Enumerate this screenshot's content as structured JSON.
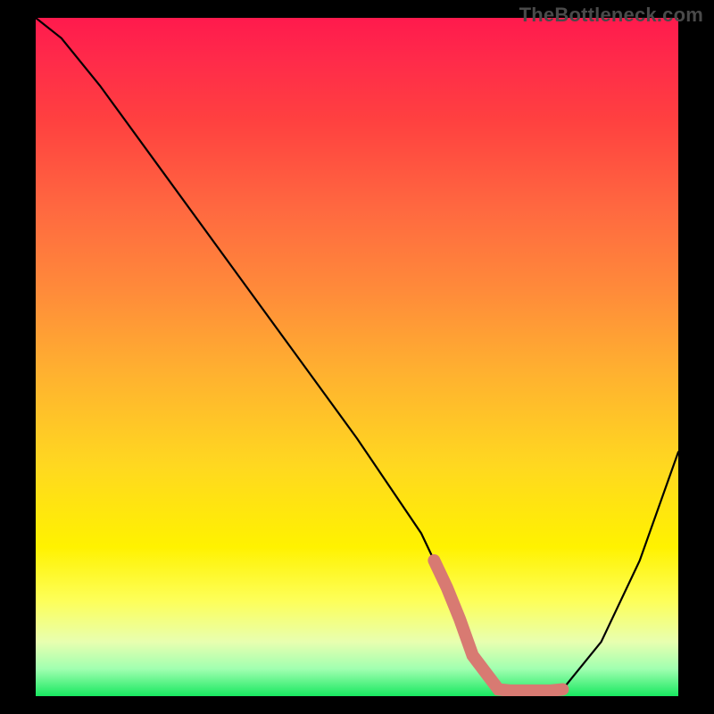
{
  "watermark": "TheBottleneck.com",
  "chart_data": {
    "type": "line",
    "title": "",
    "xlabel": "",
    "ylabel": "",
    "xlim": [
      0,
      100
    ],
    "ylim": [
      0,
      100
    ],
    "series": [
      {
        "name": "curve",
        "x": [
          0,
          4,
          10,
          20,
          30,
          40,
          50,
          60,
          65,
          68,
          72,
          78,
          82,
          88,
          94,
          100
        ],
        "y": [
          100,
          97,
          90,
          77,
          64,
          51,
          38,
          24,
          14,
          6,
          1,
          0,
          1,
          8,
          20,
          36
        ]
      }
    ],
    "highlight_segment": {
      "name": "salmon-band",
      "x": [
        62,
        82
      ],
      "y_level": 0.8,
      "color": "#d87a72"
    },
    "gradient_stops": [
      {
        "pos": 0,
        "color": "#ff1a4d"
      },
      {
        "pos": 15,
        "color": "#ff4040"
      },
      {
        "pos": 40,
        "color": "#ff8a3a"
      },
      {
        "pos": 66,
        "color": "#ffd820"
      },
      {
        "pos": 86,
        "color": "#fdff5a"
      },
      {
        "pos": 100,
        "color": "#18e860"
      }
    ]
  }
}
